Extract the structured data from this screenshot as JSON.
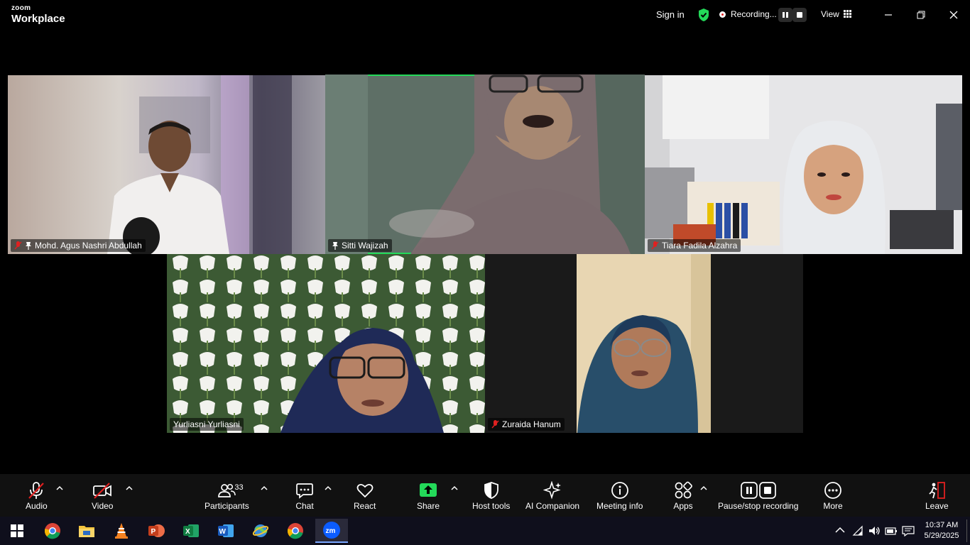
{
  "titlebar": {
    "brand_top": "zoom",
    "brand_bottom": "Workplace",
    "sign_in": "Sign in",
    "recording": "Recording...",
    "view": "View"
  },
  "participants": [
    {
      "name": "Mohd. Agus Nashri Abdullah",
      "muted": true,
      "pinned": true
    },
    {
      "name": "Sitti Wajizah",
      "muted": false,
      "pinned": true,
      "active_speaker": true
    },
    {
      "name": "Tiara Fadila Alzahra",
      "muted": true,
      "pinned": false
    },
    {
      "name": "Yurliasni Yurliasni",
      "muted": false,
      "pinned": false
    },
    {
      "name": "Zuraida Hanum",
      "muted": true,
      "pinned": false
    }
  ],
  "toolbar": {
    "audio": "Audio",
    "video": "Video",
    "participants": "Participants",
    "participants_count": "33",
    "chat": "Chat",
    "react": "React",
    "share": "Share",
    "host_tools": "Host tools",
    "ai_companion": "AI Companion",
    "meeting_info": "Meeting info",
    "apps": "Apps",
    "pause_stop": "Pause/stop recording",
    "more": "More",
    "leave": "Leave"
  },
  "taskbar": {
    "time": "10:37 AM",
    "date": "5/29/2025",
    "apps": [
      "windows-start",
      "chrome",
      "file-explorer",
      "vlc",
      "powerpoint",
      "excel",
      "word",
      "browser-globe",
      "chrome",
      "zoom"
    ]
  },
  "colors": {
    "active_speaker_border": "#23d959",
    "share_green": "#23d959",
    "muted_red": "#e02020",
    "leave_red": "#e02020"
  }
}
